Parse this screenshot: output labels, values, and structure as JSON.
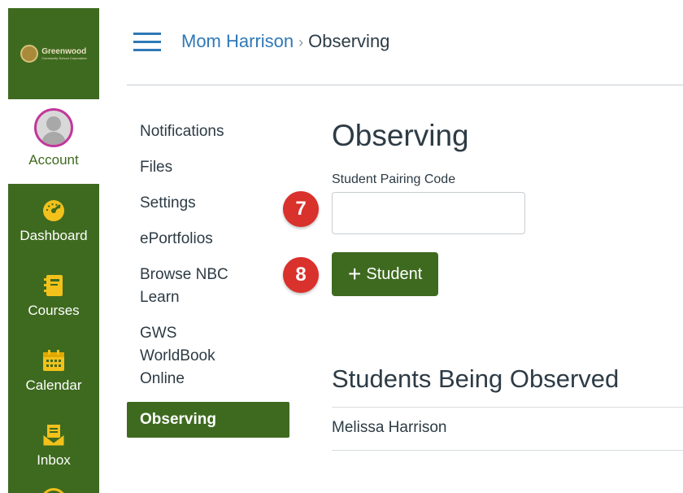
{
  "logo": {
    "name": "Greenwood",
    "tagline": "Community School Corporation"
  },
  "global_nav": {
    "account_label": "Account",
    "items": [
      {
        "label": "Dashboard",
        "icon": "dashboard-icon"
      },
      {
        "label": "Courses",
        "icon": "courses-icon"
      },
      {
        "label": "Calendar",
        "icon": "calendar-icon"
      },
      {
        "label": "Inbox",
        "icon": "inbox-icon"
      }
    ]
  },
  "header": {
    "menu_icon": "hamburger-icon",
    "breadcrumb": {
      "parent": "Mom Harrison",
      "separator": "›",
      "current": "Observing"
    }
  },
  "section_nav": {
    "items": [
      {
        "label": "Notifications"
      },
      {
        "label": "Files"
      },
      {
        "label": "Settings"
      },
      {
        "label": "ePortfolios"
      },
      {
        "label": "Browse NBC Learn"
      },
      {
        "label": "GWS WorldBook Online"
      },
      {
        "label": "Observing",
        "active": true
      }
    ]
  },
  "main": {
    "title": "Observing",
    "pairing_label": "Student Pairing Code",
    "pairing_value": "",
    "add_button_label": "Student",
    "students_title": "Students Being Observed",
    "students": [
      "Melissa Harrison"
    ]
  },
  "markers": {
    "step_7": "7",
    "step_8": "8"
  },
  "colors": {
    "brand_green": "#3e6a1f",
    "link_blue": "#2f78b7",
    "avatar_ring": "#c2389b",
    "marker_red": "#d9312b"
  }
}
